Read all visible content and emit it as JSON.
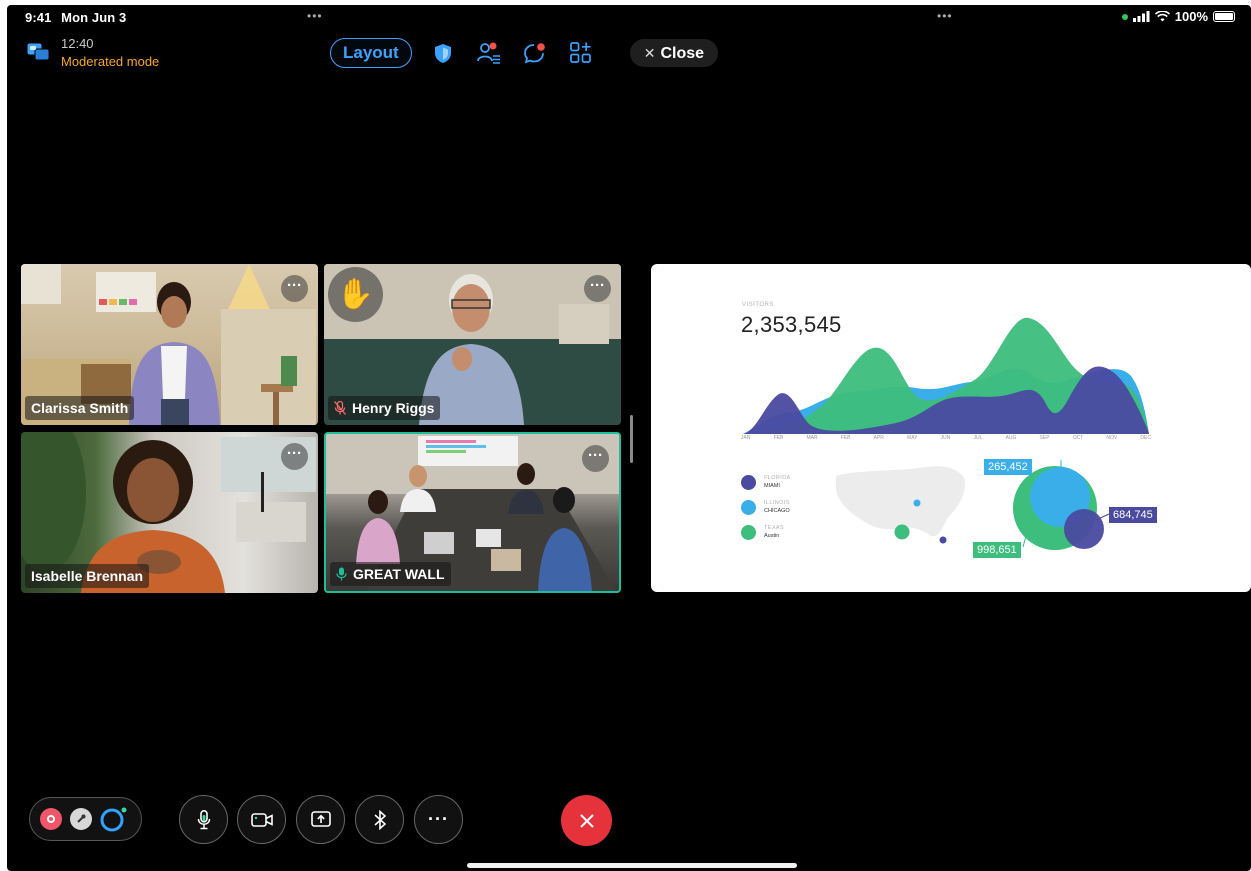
{
  "status_bar": {
    "time": "9:41",
    "date": "Mon Jun 3",
    "battery": "100%",
    "dots": "•••"
  },
  "meeting": {
    "elapsed": "12:40",
    "mode": "Moderated mode"
  },
  "toolbar": {
    "layout_label": "Layout",
    "close_label": "Close"
  },
  "participants": [
    {
      "name": "Clarissa Smith",
      "muted": false,
      "hand_raised": false
    },
    {
      "name": "Henry Riggs",
      "muted": true,
      "hand_raised": true
    },
    {
      "name": "Isabelle Brennan",
      "muted": false,
      "hand_raised": false
    },
    {
      "name": "GREAT WALL",
      "muted": false,
      "hand_raised": false,
      "active_speaker": true
    }
  ],
  "more_label": "···",
  "shared_content": {
    "visitors_label": "VISITORS",
    "visitors_total": "2,353,545",
    "months": [
      "JAN",
      "FEB",
      "MAR",
      "FEB",
      "APR",
      "MAY",
      "JUN",
      "JUL",
      "AUG",
      "SEP",
      "OCT",
      "NOV",
      "DEC"
    ],
    "legend": [
      {
        "state": "FLORIDA",
        "city": "MIAMI",
        "color": "#4a4aa0"
      },
      {
        "state": "ILLINOIS",
        "city": "CHICAGO",
        "color": "#3aaee8"
      },
      {
        "state": "TEXAS",
        "city": "Austin",
        "color": "#3dbe7c"
      }
    ],
    "bubble_values": {
      "chicago": "265,452",
      "miami": "684,745",
      "austin": "998,651"
    }
  },
  "colors": {
    "accent": "#3ba3ff",
    "mode": "#f5a623",
    "leave": "#e5323b",
    "active_border": "#1dbf9a"
  },
  "controls_more_label": "···"
}
